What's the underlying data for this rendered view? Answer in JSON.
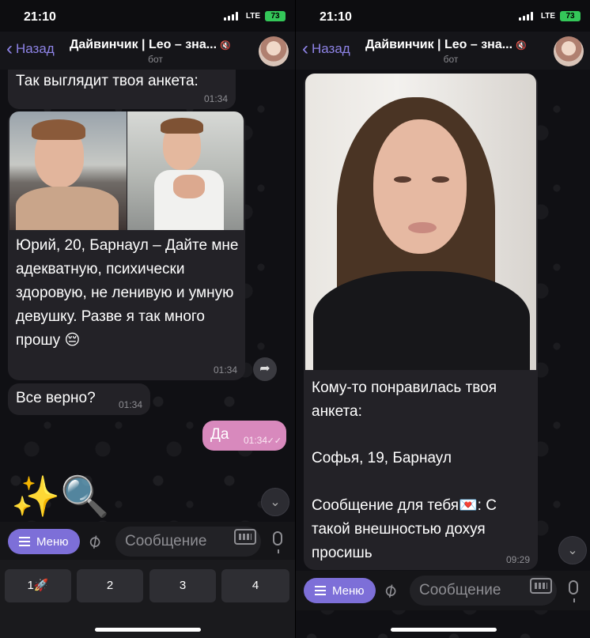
{
  "left": {
    "status": {
      "time": "21:10",
      "network": "LTE",
      "battery": "73"
    },
    "nav": {
      "back_label": "Назад",
      "title": "Дайвинчик | Leo – зна...",
      "subtitle": "бот"
    },
    "messages": [
      {
        "text": "Так выглядит твоя анкета:",
        "time": "01:34"
      },
      {
        "text": "Юрий, 20, Барнаул – Дайте мне адекватную, психически здоровую, не ленивую и умную девушку. Разве я так много прошу 😔",
        "time": "01:34"
      },
      {
        "text": "Все верно?",
        "time": "01:34"
      },
      {
        "text": "Да",
        "time": "01:34",
        "outgoing": true
      }
    ],
    "emoji_reply": "✨🔍",
    "input": {
      "menu_label": "Меню",
      "placeholder": "Сообщение"
    },
    "keyboard": [
      "1🚀",
      "2",
      "3",
      "4"
    ]
  },
  "right": {
    "status": {
      "time": "21:10",
      "network": "LTE",
      "battery": "73"
    },
    "nav": {
      "back_label": "Назад",
      "title": "Дайвинчик | Leo – зна...",
      "subtitle": "бот"
    },
    "message": {
      "line1": "Кому-то понравилась твоя анкета:",
      "line2": "Софья, 19, Барнаул",
      "line3": "Сообщение для тебя💌: С такой внешностью дохуя просишь",
      "time": "09:29"
    },
    "input": {
      "menu_label": "Меню",
      "placeholder": "Сообщение"
    }
  },
  "colors": {
    "accent": "#8e83e6",
    "menu_button": "#7d6fd8",
    "outgoing_bubble": "#d889bd",
    "incoming_bubble": "#232227",
    "battery": "#34c759"
  }
}
